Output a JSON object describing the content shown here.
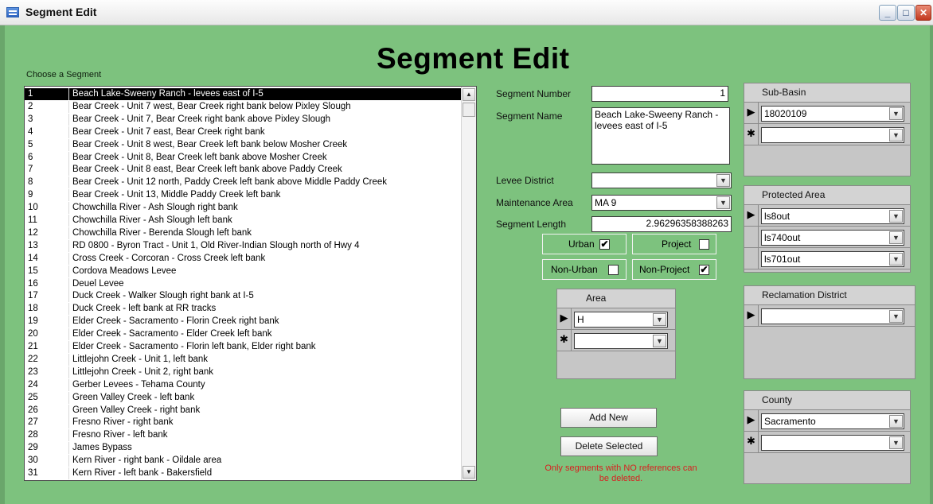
{
  "window": {
    "title": "Segment Edit"
  },
  "heading": "Segment Edit",
  "segment_list": {
    "label": "Choose a Segment",
    "rows": [
      {
        "num": "1",
        "name": "Beach Lake-Sweeny Ranch - levees east of I-5"
      },
      {
        "num": "2",
        "name": "Bear Creek - Unit 7 west, Bear Creek right bank below Pixley Slough"
      },
      {
        "num": "3",
        "name": "Bear Creek - Unit 7, Bear Creek right bank above Pixley Slough"
      },
      {
        "num": "4",
        "name": "Bear Creek - Unit 7 east, Bear Creek right bank"
      },
      {
        "num": "5",
        "name": "Bear Creek - Unit 8 west, Bear Creek left bank below Mosher Creek"
      },
      {
        "num": "6",
        "name": "Bear Creek - Unit 8, Bear Creek left bank above Mosher Creek"
      },
      {
        "num": "7",
        "name": "Bear Creek - Unit 8 east, Bear Creek left bank above Paddy Creek"
      },
      {
        "num": "8",
        "name": "Bear Creek - Unit 12 north, Paddy Creek left bank above Middle Paddy Creek"
      },
      {
        "num": "9",
        "name": "Bear Creek - Unit 13, Middle Paddy Creek left bank"
      },
      {
        "num": "10",
        "name": "Chowchilla River - Ash Slough right bank"
      },
      {
        "num": "11",
        "name": "Chowchilla River - Ash Slough left bank"
      },
      {
        "num": "12",
        "name": "Chowchilla River - Berenda Slough left bank"
      },
      {
        "num": "13",
        "name": "RD 0800 - Byron Tract - Unit 1, Old River-Indian Slough north of Hwy 4"
      },
      {
        "num": "14",
        "name": "Cross Creek - Corcoran - Cross Creek left bank"
      },
      {
        "num": "15",
        "name": "Cordova Meadows Levee"
      },
      {
        "num": "16",
        "name": "Deuel Levee"
      },
      {
        "num": "17",
        "name": "Duck Creek - Walker Slough right bank at I-5"
      },
      {
        "num": "18",
        "name": "Duck Creek - left bank at RR tracks"
      },
      {
        "num": "19",
        "name": "Elder Creek - Sacramento - Florin Creek right bank"
      },
      {
        "num": "20",
        "name": "Elder Creek - Sacramento - Elder Creek left bank"
      },
      {
        "num": "21",
        "name": "Elder Creek - Sacramento - Florin left bank, Elder right bank"
      },
      {
        "num": "22",
        "name": "Littlejohn Creek - Unit 1, left bank"
      },
      {
        "num": "23",
        "name": "Littlejohn Creek - Unit 2, right bank"
      },
      {
        "num": "24",
        "name": "Gerber Levees - Tehama County"
      },
      {
        "num": "25",
        "name": "Green Valley Creek - left bank"
      },
      {
        "num": "26",
        "name": "Green Valley Creek - right bank"
      },
      {
        "num": "27",
        "name": "Fresno River - right bank"
      },
      {
        "num": "28",
        "name": "Fresno River - left bank"
      },
      {
        "num": "29",
        "name": "James Bypass"
      },
      {
        "num": "30",
        "name": "Kern River - right bank - Oildale area"
      },
      {
        "num": "31",
        "name": "Kern River - left bank - Bakersfield"
      }
    ]
  },
  "fields": {
    "segment_number": {
      "label": "Segment Number",
      "value": "1"
    },
    "segment_name": {
      "label": "Segment Name",
      "value": "Beach Lake-Sweeny Ranch - levees east of I-5"
    },
    "levee_district": {
      "label": "Levee District",
      "value": ""
    },
    "maintenance_area": {
      "label": "Maintenance Area",
      "value": "MA 9"
    },
    "segment_length": {
      "label": "Segment Length",
      "value": "2.96296358388263"
    }
  },
  "checkboxes": {
    "urban": {
      "label": "Urban",
      "checked": "✔"
    },
    "project": {
      "label": "Project",
      "checked": ""
    },
    "non_urban": {
      "label": "Non-Urban",
      "checked": ""
    },
    "non_project": {
      "label": "Non-Project",
      "checked": "✔"
    }
  },
  "area": {
    "header": "Area",
    "rows": [
      {
        "value": "H"
      },
      {
        "value": ""
      }
    ]
  },
  "sub_basin": {
    "header": "Sub-Basin",
    "rows": [
      {
        "value": "18020109"
      },
      {
        "value": ""
      }
    ]
  },
  "protected_area": {
    "header": "Protected Area",
    "rows": [
      {
        "value": "ls8out"
      },
      {
        "value": "ls740out"
      },
      {
        "value": "ls701out"
      }
    ]
  },
  "reclamation_district": {
    "header": "Reclamation District",
    "rows": [
      {
        "value": ""
      }
    ]
  },
  "county": {
    "header": "County",
    "rows": [
      {
        "value": "Sacramento"
      },
      {
        "value": ""
      }
    ]
  },
  "buttons": {
    "add_new": "Add New",
    "delete_selected": "Delete Selected"
  },
  "warning": "Only segments with NO references can be deleted.",
  "glyphs": {
    "record_current": "▶",
    "record_new": "✱",
    "dropdown": "▼",
    "scroll_up": "▲",
    "scroll_down": "▼",
    "minimize": "_",
    "maximize": "□",
    "close": "✕"
  }
}
